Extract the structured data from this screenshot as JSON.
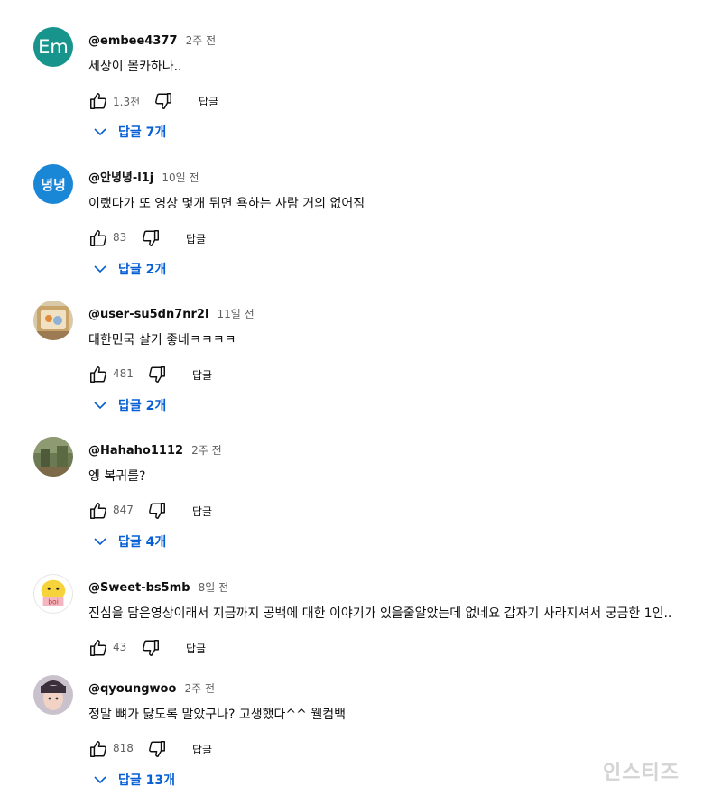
{
  "comments": [
    {
      "author": "@embee4377",
      "time": "2주 전",
      "text": "세상이 몰카하나..",
      "likes": "1.3천",
      "reply": "답글",
      "replies": "답글 7개",
      "avatar_text": "Em"
    },
    {
      "author": "@안녕녕-l1j",
      "time": "10일 전",
      "text": "이랬다가 또 영상 몇개 뒤면 욕하는 사람 거의 없어짐",
      "likes": "83",
      "reply": "답글",
      "replies": "답글 2개",
      "avatar_text": "녕녕"
    },
    {
      "author": "@user-su5dn7nr2l",
      "time": "11일 전",
      "text": "대한민국 살기 좋네ㅋㅋㅋㅋ",
      "likes": "481",
      "reply": "답글",
      "replies": "답글 2개"
    },
    {
      "author": "@Hahaho1112",
      "time": "2주 전",
      "text": "엥 복귀를?",
      "likes": "847",
      "reply": "답글",
      "replies": "답글 4개"
    },
    {
      "author": "@Sweet-bs5mb",
      "time": "8일 전",
      "text": "진심을 담은영상이래서 지금까지 공백에 대한 이야기가 있을줄알았는데 없네요 갑자기 사라지셔서 궁금한 1인..",
      "likes": "43",
      "reply": "답글",
      "avatar_text": "boi"
    },
    {
      "author": "@qyoungwoo",
      "time": "2주 전",
      "text": "정말 뼈가 닳도록 말았구나? 고생했다^^ 웰컴백",
      "likes": "818",
      "reply": "답글",
      "replies": "답글 13개"
    }
  ],
  "watermark": "인스티즈",
  "colors": {
    "link": "#065fd4",
    "meta": "#606060",
    "em_avatar": "#17958d",
    "ny_avatar": "#1a86d6"
  }
}
